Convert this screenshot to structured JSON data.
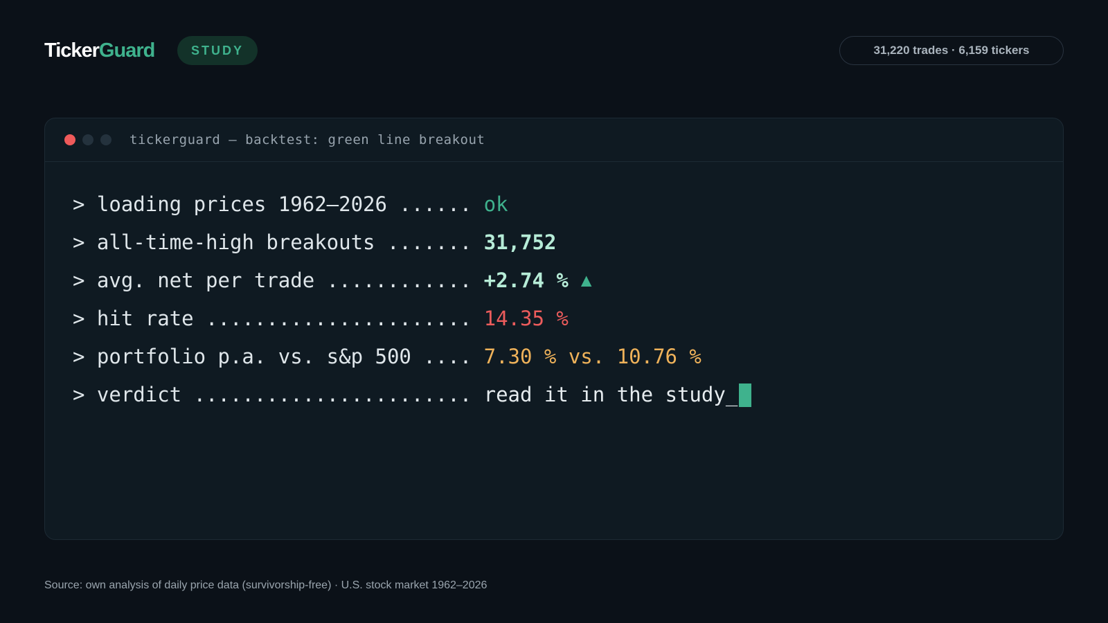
{
  "header": {
    "brand_primary": "Ticker",
    "brand_accent": "Guard",
    "badge": "STUDY",
    "stats": "31,220 trades · 6,159 tickers"
  },
  "terminal": {
    "title": "tickerguard — backtest: green line breakout",
    "lines": [
      {
        "prompt": "> loading prices 1962–2026 ...... ",
        "value": "ok",
        "style": "ok"
      },
      {
        "prompt": "> all-time-high breakouts ....... ",
        "value": "31,752",
        "style": "mint"
      },
      {
        "prompt": "> avg. net per trade ............ ",
        "value": "+2.74 %",
        "style": "mint",
        "icon": "up-triangle-icon"
      },
      {
        "prompt": "> hit rate ...................... ",
        "value": "14.35 %",
        "style": "red"
      },
      {
        "prompt": "> portfolio p.a. vs. s&p 500 .... ",
        "value": "7.30 % vs. 10.76 %",
        "style": "amber"
      },
      {
        "prompt": "> verdict ....................... ",
        "value": "read it in the study_",
        "style": "plain",
        "cursor": true
      }
    ]
  },
  "footer": {
    "source": "Source: own analysis of daily price data (survivorship-free) · U.S. stock market 1962–2026"
  },
  "colors": {
    "background": "#0b1118",
    "accent": "#3fb28d",
    "negative": "#ec5c5c",
    "warning": "#efb25a"
  }
}
